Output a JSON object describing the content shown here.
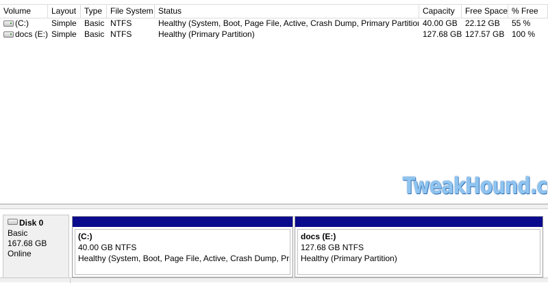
{
  "table": {
    "columns": [
      "Volume",
      "Layout",
      "Type",
      "File System",
      "Status",
      "Capacity",
      "Free Space",
      "% Free"
    ],
    "rows": [
      {
        "volume": "(C:)",
        "layout": "Simple",
        "type": "Basic",
        "fs": "NTFS",
        "status": "Healthy (System, Boot, Page File, Active, Crash Dump, Primary Partition)",
        "capacity": "40.00 GB",
        "free": "22.12 GB",
        "pct": "55 %"
      },
      {
        "volume": "docs (E:)",
        "layout": "Simple",
        "type": "Basic",
        "fs": "NTFS",
        "status": "Healthy (Primary Partition)",
        "capacity": "127.68 GB",
        "free": "127.57 GB",
        "pct": "100 %"
      }
    ]
  },
  "watermark": "TweakHound.com",
  "disk": {
    "name": "Disk 0",
    "type": "Basic",
    "size": "167.68 GB",
    "status": "Online",
    "partitions": [
      {
        "name": "(C:)",
        "size_fs": "40.00 GB NTFS",
        "status": "Healthy (System, Boot, Page File, Active, Crash Dump, Prima"
      },
      {
        "name": "docs  (E:)",
        "size_fs": "127.68 GB NTFS",
        "status": "Healthy (Primary Partition)"
      }
    ]
  },
  "colors": {
    "partition_bar": "#0a0a8c",
    "pane_background": "#f0f0f0",
    "grid_line": "#dcdcdc"
  },
  "icons": {
    "drive": "drive-icon",
    "disk": "disk-icon"
  }
}
